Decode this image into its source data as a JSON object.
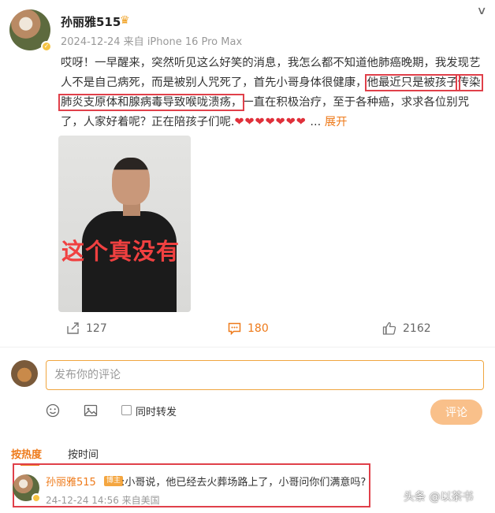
{
  "author": {
    "name": "孙丽雅515",
    "meta": "2024-12-24 来自 iPhone 16 Pro Max"
  },
  "post": {
    "text_before": "哎呀！一早醒来，突然听见这么好笑的消息，我怎么都不知道他肺癌晚期，我发现艺人不是自己病死，而是被别人咒死了，首先小哥身体很健康，",
    "highlight_1": "他最近只是被孩子",
    "highlight_2": "传染肺炎支原体和腺病毒导致喉咙溃疡，",
    "text_after": "一直在积极治疗，至于各种癌，求求各位别咒了，人家好着呢？正在陪孩子们呢.",
    "hearts": "❤❤❤❤❤❤❤",
    "ellipsis": " ... ",
    "expand": "展开"
  },
  "image_overlay_text": "这个真没有",
  "actions": {
    "share_count": "127",
    "comment_count": "180",
    "like_count": "2162"
  },
  "comment_box": {
    "placeholder": "发布你的评论",
    "repost_label": "同时转发",
    "submit_label": "评论"
  },
  "sort_tabs": {
    "hot": "按热度",
    "time": "按时间"
  },
  "reply": {
    "name": "孙丽雅515",
    "badge": "博主",
    "text": ":小哥说，他已经去火葬场路上了，小哥问你们满意吗?",
    "meta": "24-12-24 14:56 来自美国"
  },
  "watermark": "头条 @以茶书",
  "colors": {
    "accent": "#ee7a1a",
    "highlight_border": "#e0404a",
    "heart": "#e0303a"
  }
}
